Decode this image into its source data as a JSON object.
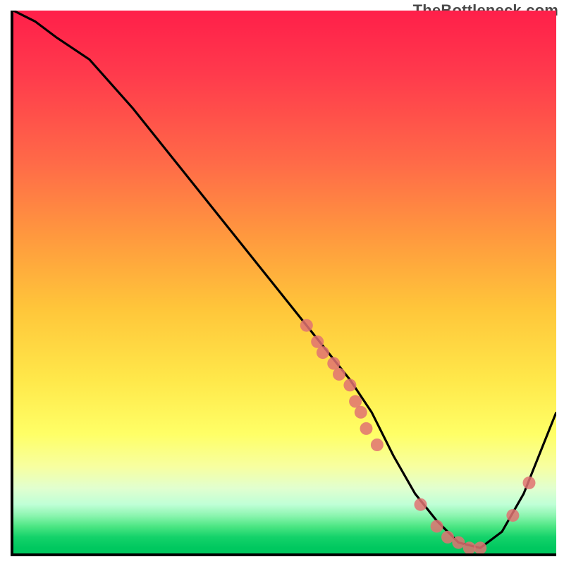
{
  "watermark": "TheBottleneck.com",
  "chart_data": {
    "type": "line",
    "title": "",
    "xlabel": "",
    "ylabel": "",
    "xlim": [
      0,
      100
    ],
    "ylim": [
      0,
      100
    ],
    "grid": false,
    "legend": false,
    "curve": {
      "x": [
        0,
        4,
        8,
        14,
        22,
        30,
        38,
        46,
        54,
        58,
        62,
        66,
        70,
        74,
        78,
        82,
        86,
        90,
        94,
        98,
        100
      ],
      "y": [
        100,
        98,
        95,
        91,
        82,
        72,
        62,
        52,
        42,
        37,
        32,
        26,
        18,
        11,
        6,
        2,
        1,
        4,
        11,
        21,
        26
      ]
    },
    "markers": {
      "color": "#e07272",
      "radius_px": 9,
      "points": [
        {
          "x": 54,
          "y": 42
        },
        {
          "x": 56,
          "y": 39
        },
        {
          "x": 57,
          "y": 37
        },
        {
          "x": 59,
          "y": 35
        },
        {
          "x": 60,
          "y": 33
        },
        {
          "x": 62,
          "y": 31
        },
        {
          "x": 63,
          "y": 28
        },
        {
          "x": 64,
          "y": 26
        },
        {
          "x": 65,
          "y": 23
        },
        {
          "x": 67,
          "y": 20
        },
        {
          "x": 75,
          "y": 9
        },
        {
          "x": 78,
          "y": 5
        },
        {
          "x": 80,
          "y": 3
        },
        {
          "x": 82,
          "y": 2
        },
        {
          "x": 84,
          "y": 1
        },
        {
          "x": 86,
          "y": 1
        },
        {
          "x": 92,
          "y": 7
        },
        {
          "x": 95,
          "y": 13
        }
      ]
    }
  }
}
